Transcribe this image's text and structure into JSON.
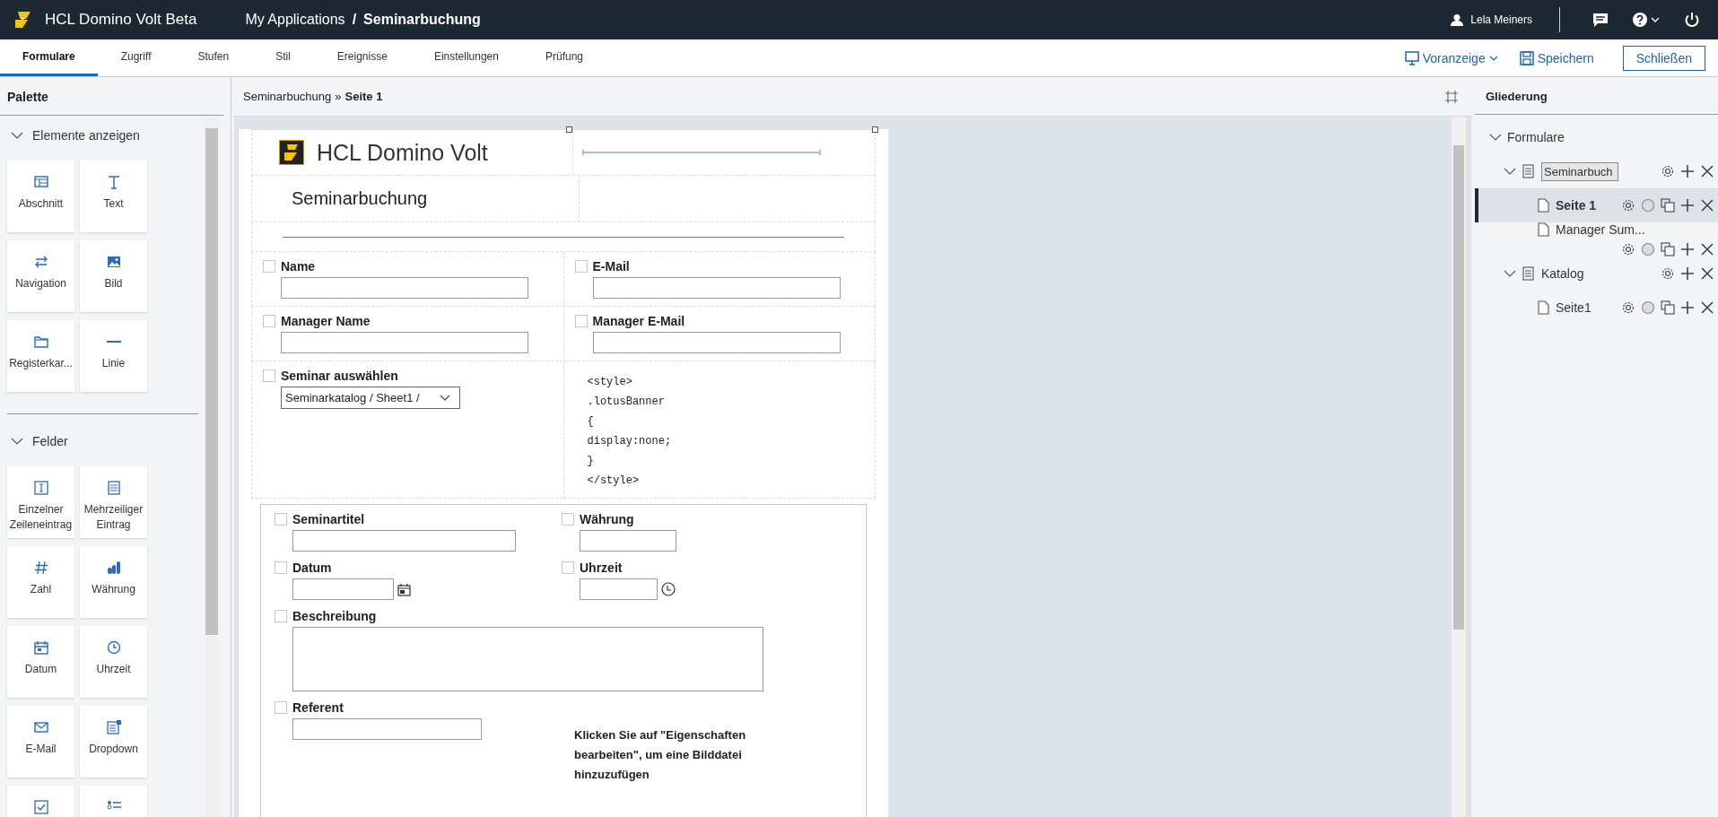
{
  "app_bar": {
    "product": "HCL Domino Volt Beta",
    "breadcrumb": "My Applications",
    "separator": "/",
    "app_name": "Seminarbuchung",
    "user": "Lela Meiners"
  },
  "tabs": [
    {
      "label": "Formulare",
      "selected": true
    },
    {
      "label": "Zugriff",
      "selected": false
    },
    {
      "label": "Stufen",
      "selected": false
    },
    {
      "label": "Stil",
      "selected": false
    },
    {
      "label": "Ereignisse",
      "selected": false
    },
    {
      "label": "Einstellungen",
      "selected": false
    },
    {
      "label": "Prüfung",
      "selected": false
    }
  ],
  "toolbar": {
    "preview": "Voranzeige",
    "save": "Speichern",
    "close": "Schließen"
  },
  "palette": {
    "title": "Palette",
    "sections": [
      {
        "title": "Elemente anzeigen",
        "expanded": true,
        "items": [
          {
            "kind": "section",
            "label": "Abschnitt"
          },
          {
            "kind": "text",
            "label": "Text"
          },
          {
            "kind": "navigation",
            "label": "Navigation"
          },
          {
            "kind": "image",
            "label": "Bild"
          },
          {
            "kind": "tabs",
            "label": "Registerkar..."
          },
          {
            "kind": "line",
            "label": "Linie"
          }
        ]
      },
      {
        "title": "Felder",
        "expanded": true,
        "items": [
          {
            "kind": "singleline",
            "label": "Einzelner Zeileneintrag"
          },
          {
            "kind": "multiline",
            "label": "Mehrzeiliger Eintrag"
          },
          {
            "kind": "number",
            "label": "Zahl"
          },
          {
            "kind": "currency",
            "label": "Währung"
          },
          {
            "kind": "date",
            "label": "Datum"
          },
          {
            "kind": "time",
            "label": "Uhrzeit"
          },
          {
            "kind": "email",
            "label": "E-Mail"
          },
          {
            "kind": "dropdown",
            "label": "Dropdown"
          },
          {
            "kind": "checkbox"
          },
          {
            "kind": "list"
          }
        ]
      }
    ]
  },
  "breadcrumb": {
    "form": "Seminarbuchung",
    "separator": "»",
    "page": "Seite 1"
  },
  "form": {
    "logo_text": "HCL Domino Volt",
    "title": "Seminarbuchung",
    "rows": [
      [
        {
          "kind": "text",
          "label": "Name",
          "checked": false
        },
        {
          "kind": "text",
          "label": "E-Mail",
          "checked": false
        }
      ],
      [
        {
          "kind": "text",
          "label": "Manager Name",
          "checked": false
        },
        {
          "kind": "text",
          "label": "Manager E-Mail",
          "checked": false
        }
      ],
      [
        {
          "kind": "select",
          "label": "Seminar auswählen",
          "checked": false,
          "value": "Seminarkatalog / Sheet1 /"
        },
        {
          "kind": "code",
          "lines": [
            "<style>",
            ".lotusBanner",
            "{",
            "display:none;",
            "}",
            "</style>"
          ]
        }
      ]
    ],
    "section": [
      [
        {
          "kind": "text",
          "label": "Seminartitel",
          "checked": false
        },
        {
          "kind": "text",
          "label": "Währung",
          "checked": false
        }
      ],
      [
        {
          "kind": "date",
          "label": "Datum",
          "checked": false
        },
        {
          "kind": "time",
          "label": "Uhrzeit",
          "checked": false
        }
      ],
      [
        {
          "kind": "textarea",
          "label": "Beschreibung",
          "checked": false
        }
      ],
      [
        {
          "kind": "text",
          "label": "Referent",
          "checked": false
        },
        {
          "kind": "hint",
          "text": "Klicken Sie auf \"Eigenschaften bearbeiten\", um eine Bilddatei hinzuzufügen"
        }
      ]
    ]
  },
  "outline": {
    "title": "Gliederung",
    "tree": [
      {
        "kind": "folder",
        "label": "Formulare",
        "expanded": true,
        "selected": false,
        "children": [
          {
            "kind": "form",
            "label": "Seminarbuch",
            "editing": true,
            "expanded": true,
            "selected": false,
            "children": [
              {
                "kind": "page",
                "label": "Seite 1",
                "selected": true
              },
              {
                "kind": "page",
                "label": "Manager Sum...",
                "selected": false
              }
            ]
          },
          {
            "kind": "form",
            "label": "Katalog",
            "editing": false,
            "expanded": true,
            "selected": false,
            "children": [
              {
                "kind": "page",
                "label": "Seite1",
                "selected": false
              }
            ]
          }
        ]
      }
    ]
  }
}
